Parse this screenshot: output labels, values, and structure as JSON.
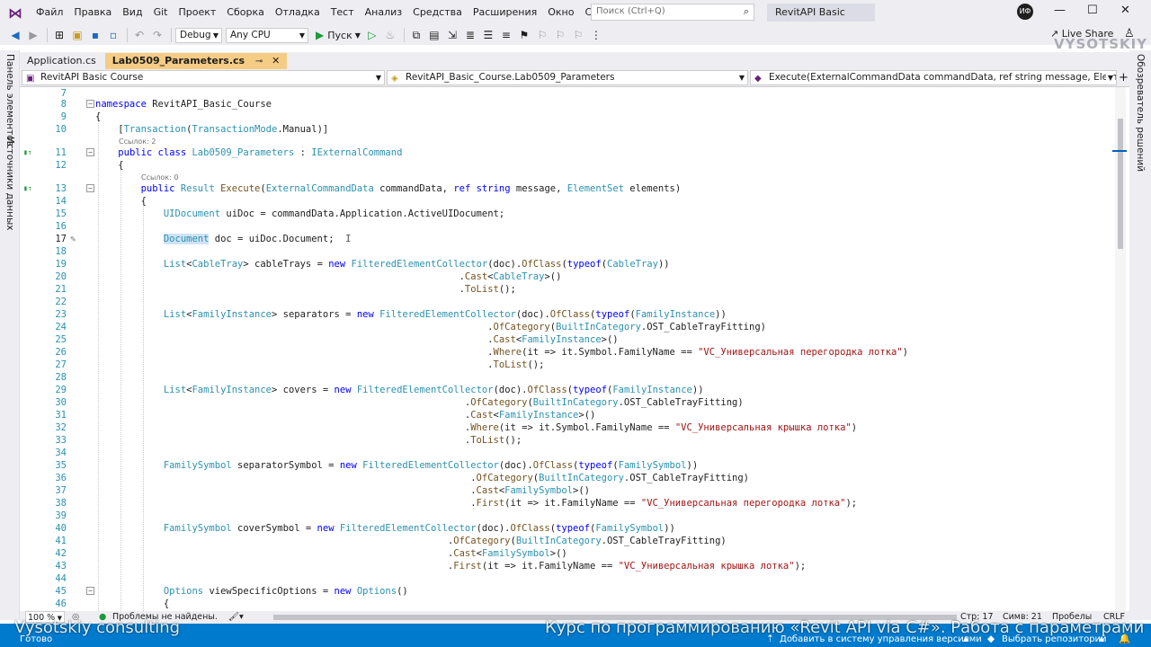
{
  "menubar": {
    "items": [
      "Файл",
      "Правка",
      "Вид",
      "Git",
      "Проект",
      "Сборка",
      "Отладка",
      "Тест",
      "Анализ",
      "Средства",
      "Расширения",
      "Окно",
      "Справка"
    ],
    "search_placeholder": "Поиск (Ctrl+Q)",
    "solution_title": "RevitAPI Basic Course",
    "avatar_initials": "ИФ"
  },
  "toolbar": {
    "config": "Debug",
    "platform": "Any CPU",
    "run_label": "Пуск",
    "live_share": "Live Share",
    "watermark": "VYSOTSKIY"
  },
  "side_panels": {
    "left_1": "Панель элементов",
    "left_2": "Источники данных",
    "right_1": "Обозреватель решений"
  },
  "tabs": [
    {
      "label": "Application.cs"
    },
    {
      "label": "Lab0509_Parameters.cs"
    }
  ],
  "navbar": {
    "project": "RevitAPI Basic Course",
    "type": "RevitAPI_Basic_Course.Lab0509_Parameters",
    "member": "Execute(ExternalCommandData commandData, ref string message, ElementSet elem"
  },
  "codelens": {
    "refs_2": "Ссылок: 2",
    "refs_0": "Ссылок: 0"
  },
  "status": {
    "zoom": "100 %",
    "problems": "Проблемы не найдены.",
    "line": "Стр: 17",
    "col": "Симв: 21",
    "spaces": "Пробелы",
    "eol": "CRLF",
    "ready": "Готово",
    "add_vcs": "Добавить в систему управления версиями",
    "select_repo": "Выбрать репозиторий",
    "overlay_left": "Vysotskiy consulting",
    "overlay_right": "Курс по программированию «Revit API via C#». Работа с параметрами"
  }
}
